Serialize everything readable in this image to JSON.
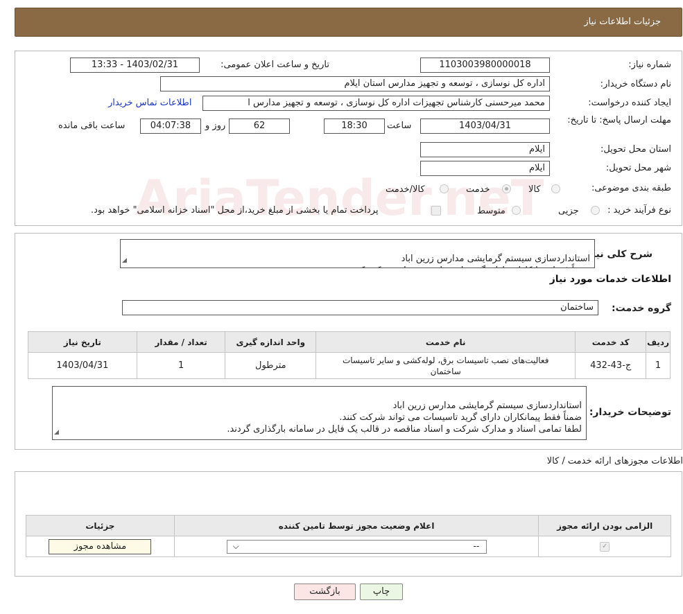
{
  "header": {
    "title": "جزئیات اطلاعات نیاز"
  },
  "need": {
    "number_label": "شماره نیاز:",
    "number_value": "1103003980000018",
    "announce_label": "تاریخ و ساعت اعلان عمومی:",
    "announce_value": "1403/02/31 - 13:33",
    "buyer_label": "نام دستگاه خریدار:",
    "buyer_value": "اداره کل نوسازی ، توسعه و تجهیز مدارس استان ایلام",
    "creator_label": "ایجاد کننده درخواست:",
    "creator_value": "محمد میرحسنی کارشناس تجهیزات اداره کل نوسازی ، توسعه و تجهیز مدارس ا",
    "contact_link": "اطلاعات تماس خریدار",
    "deadline_label": "مهلت ارسال پاسخ: تا تاریخ:",
    "deadline_date": "1403/04/31",
    "time_label": "ساعت",
    "deadline_time": "18:30",
    "days_value": "62",
    "days_label": "روز و",
    "remaining_value": "04:07:38",
    "remaining_label": "ساعت باقی مانده",
    "province_label": "استان محل تحویل:",
    "province_value": "ایلام",
    "city_label": "شهر محل تحویل:",
    "city_value": "ایلام",
    "category_label": "طبقه بندی موضوعی:",
    "category_options": [
      "کالا",
      "خدمت",
      "کالا/خدمت"
    ],
    "category_selected": "خدمت",
    "process_label": "نوع فرآیند خرید :",
    "process_options": [
      "جزیی",
      "متوسط"
    ],
    "payment_note": "پرداخت تمام یا بخشی از مبلغ خرید،از محل \"اسناد خزانه اسلامی\" خواهد بود."
  },
  "summary": {
    "label": "شرح کلی نیاز:",
    "text": "استانداردسازی سیستم گرمایشی مدارس زرین اباد\nضمناً فقط پیمانکاران دارای گرید تاسیسات می تواند شرکت کنند."
  },
  "services": {
    "title": "اطلاعات خدمات مورد نیاز",
    "group_label": "گروه خدمت:",
    "group_value": "ساختمان",
    "columns": [
      "ردیف",
      "کد خدمت",
      "نام خدمت",
      "واحد اندازه گیری",
      "تعداد / مقدار",
      "تاریخ نیاز"
    ],
    "rows": [
      {
        "row": "1",
        "code": "ج-43-432",
        "name": "فعالیت‌های نصب تاسیسات برق، لوله‌کشی و سایر تاسیسات ساختمان",
        "unit": "مترطول",
        "qty": "1",
        "date": "1403/04/31"
      }
    ]
  },
  "buyer_notes": {
    "label": "توضیحات خریدار:",
    "text": "استانداردسازی سیستم گرمایشی مدارس زرین اباد\nضمناً فقط پیمانکاران دارای گرید تاسیسات می تواند شرکت کنند.\nلطفا تمامی اسناد و مدارک شرکت و اسناد مناقصه در قالب یک فایل در سامانه بارگذاری گردند."
  },
  "permits": {
    "title": "اطلاعات مجوزهای ارائه خدمت / کالا",
    "columns": [
      "الزامی بودن ارائه مجوز",
      "اعلام وضعیت مجوز توسط تامین کننده",
      "جزئیات"
    ],
    "select_value": "--",
    "view_button": "مشاهده مجوز"
  },
  "footer": {
    "print_button": "چاپ",
    "back_button": "بازگشت"
  },
  "watermark": "AriaTender.neT"
}
